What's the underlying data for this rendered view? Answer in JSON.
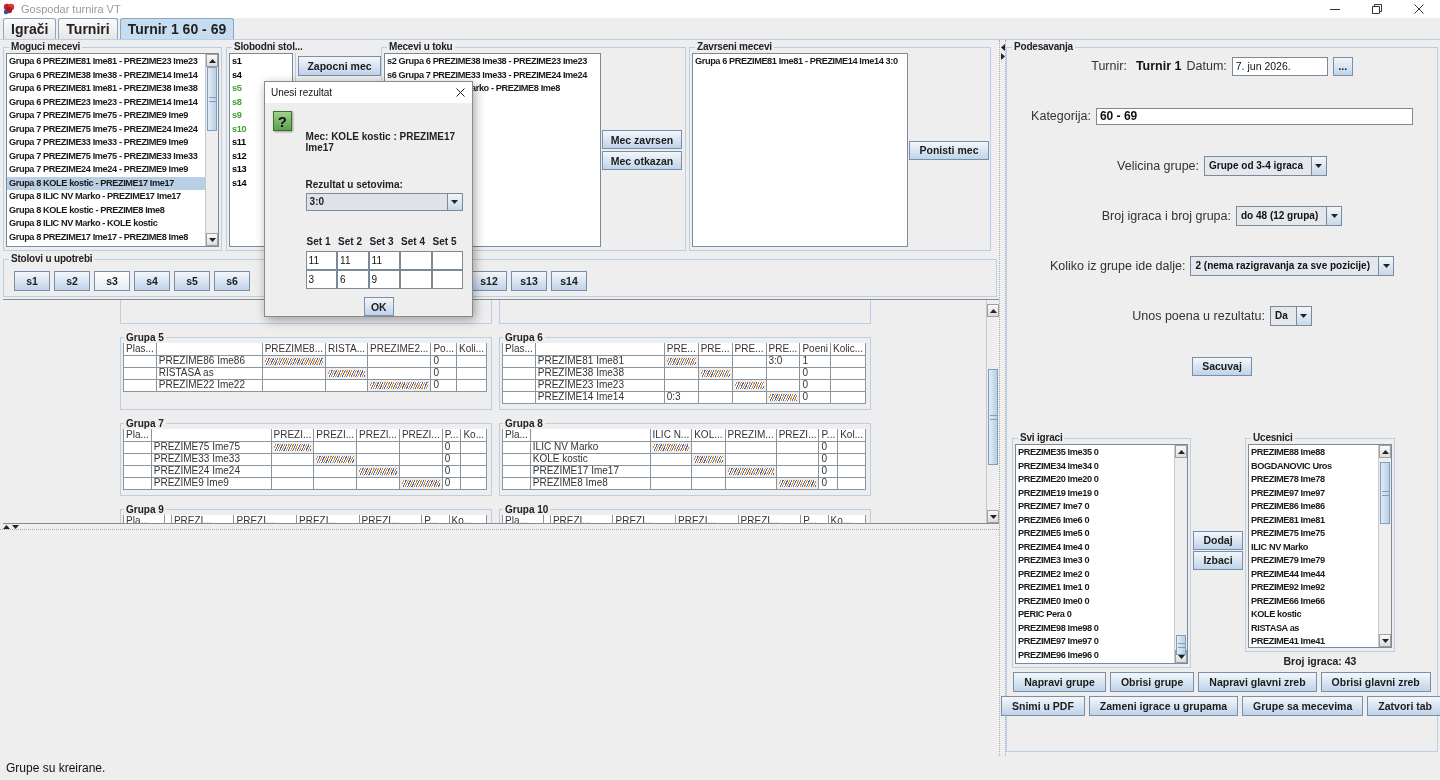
{
  "window": {
    "title": "Gospodar turnira VT"
  },
  "tabs": [
    {
      "label": "Igrači",
      "selected": false
    },
    {
      "label": "Turniri",
      "selected": false
    },
    {
      "label": "Turnir 1 60 - 69",
      "selected": true
    }
  ],
  "possible_matches": {
    "title": "Moguci mecevi",
    "items": [
      {
        "label": "Grupa 6 PREZIME81 Ime81 - PREZIME23 Ime23",
        "selected": false
      },
      {
        "label": "Grupa 6 PREZIME38 Ime38 - PREZIME14 Ime14",
        "selected": false
      },
      {
        "label": "Grupa 6 PREZIME81 Ime81 - PREZIME38 Ime38",
        "selected": false
      },
      {
        "label": "Grupa 6 PREZIME23 Ime23 - PREZIME14 Ime14",
        "selected": false
      },
      {
        "label": "Grupa 7 PREZIME75 Ime75 - PREZIME9 Ime9",
        "selected": false
      },
      {
        "label": "Grupa 7 PREZIME75 Ime75 - PREZIME24 Ime24",
        "selected": false
      },
      {
        "label": "Grupa 7 PREZIME33 Ime33 - PREZIME9 Ime9",
        "selected": false
      },
      {
        "label": "Grupa 7 PREZIME75 Ime75 - PREZIME33 Ime33",
        "selected": false
      },
      {
        "label": "Grupa 7 PREZIME24 Ime24 - PREZIME9 Ime9",
        "selected": false
      },
      {
        "label": "Grupa 8 KOLE kostic - PREZIME17 Ime17",
        "selected": true
      },
      {
        "label": "Grupa 8 ILIC NV Marko - PREZIME17 Ime17",
        "selected": false
      },
      {
        "label": "Grupa 8 KOLE kostic - PREZIME8 Ime8",
        "selected": false
      },
      {
        "label": "Grupa 8 ILIC NV Marko - KOLE kostic",
        "selected": false
      },
      {
        "label": "Grupa 8 PREZIME17 Ime17 - PREZIME8 Ime8",
        "selected": false
      }
    ]
  },
  "free_tables": {
    "title": "Slobodni stol...",
    "items": [
      {
        "label": "s1",
        "color": "#000000"
      },
      {
        "label": "s4",
        "color": "#000000"
      },
      {
        "label": "s5",
        "color": "#3f9f2f"
      },
      {
        "label": "s8",
        "color": "#3f9f2f"
      },
      {
        "label": "s9",
        "color": "#3f9f2f"
      },
      {
        "label": "s10",
        "color": "#3f9f2f"
      },
      {
        "label": "s11",
        "color": "#000000"
      },
      {
        "label": "s12",
        "color": "#000000"
      },
      {
        "label": "s13",
        "color": "#000000"
      },
      {
        "label": "s14",
        "color": "#000000"
      }
    ]
  },
  "start_button": "Zapocni mec",
  "matches_in_progress": {
    "title": "Mecevi u toku",
    "items": [
      {
        "label": "s2 Grupa 6 PREZIME38 Ime38 - PREZIME23 Ime23",
        "clipped": false
      },
      {
        "label": "s6 Grupa 7 PREZIME33 Ime33 - PREZIME24 Ime24",
        "clipped": false
      },
      {
        "label": "arko - PREZIME8 Ime8",
        "clipped": true
      }
    ],
    "buttons": [
      "Mec zavrsen",
      "Mec otkazan"
    ]
  },
  "finished_matches": {
    "title": "Zavrseni mecevi",
    "items": [
      "Grupa 6 PREZIME81 Ime81 - PREZIME14 Ime14 3:0"
    ],
    "button": "Ponisti mec"
  },
  "tables_in_use": {
    "title": "Stolovi u upotrebi",
    "buttons": [
      {
        "label": "s1",
        "highlighted": false
      },
      {
        "label": "s2",
        "highlighted": false
      },
      {
        "label": "s3",
        "highlighted": true
      },
      {
        "label": "s4",
        "highlighted": false
      },
      {
        "label": "s5",
        "highlighted": false
      },
      {
        "label": "s6",
        "highlighted": false
      },
      {
        "label": "s12",
        "highlighted": false
      },
      {
        "label": "s13",
        "highlighted": false
      },
      {
        "label": "s14",
        "highlighted": false
      }
    ]
  },
  "groups": [
    {
      "title": "Grupa 5",
      "columns": [
        "Plas...",
        null,
        "PREZIME8...",
        "RISTA...",
        "PREZIME2...",
        "Po...",
        "Koli..."
      ],
      "rows": [
        [
          null,
          "PREZIME86 Ime86",
          {
            "kind": "hatch"
          },
          null,
          null,
          "0",
          null
        ],
        [
          null,
          "RISTASA as",
          null,
          {
            "kind": "hatch"
          },
          null,
          "0",
          null
        ],
        [
          null,
          "PREZIME22 Ime22",
          null,
          null,
          {
            "kind": "hatch"
          },
          "0",
          null
        ]
      ]
    },
    {
      "title": "Grupa 6",
      "columns": [
        "Plas...",
        null,
        "PRE...",
        "PRE...",
        "PRE...",
        "PRE...",
        "Poeni",
        "Kolic..."
      ],
      "rows": [
        [
          null,
          "PREZIME81 Ime81",
          {
            "kind": "hatch"
          },
          null,
          null,
          "3:0",
          "1",
          null
        ],
        [
          null,
          "PREZIME38 Ime38",
          null,
          {
            "kind": "hatch"
          },
          null,
          null,
          "0",
          null
        ],
        [
          null,
          "PREZIME23 Ime23",
          null,
          null,
          {
            "kind": "hatch"
          },
          null,
          "0",
          null
        ],
        [
          null,
          "PREZIME14 Ime14",
          "0:3",
          null,
          null,
          {
            "kind": "hatch"
          },
          "0",
          null
        ]
      ]
    },
    {
      "title": "Grupa 7",
      "columns": [
        "Pla...",
        null,
        "PREZI...",
        "PREZI...",
        "PREZI...",
        "PREZI...",
        "P...",
        "Ko..."
      ],
      "rows": [
        [
          null,
          "PREZIME75 Ime75",
          {
            "kind": "hatch"
          },
          null,
          null,
          null,
          "0",
          null
        ],
        [
          null,
          "PREZIME33 Ime33",
          null,
          {
            "kind": "hatch"
          },
          null,
          null,
          "0",
          null
        ],
        [
          null,
          "PREZIME24 Ime24",
          null,
          null,
          {
            "kind": "hatch"
          },
          null,
          "0",
          null
        ],
        [
          null,
          "PREZIME9 Ime9",
          null,
          null,
          null,
          {
            "kind": "hatch"
          },
          "0",
          null
        ]
      ]
    },
    {
      "title": "Grupa 8",
      "columns": [
        "Pla...",
        null,
        "ILIC N...",
        "KOL...",
        "PREZIM...",
        "PREZI...",
        "P...",
        "Kol..."
      ],
      "rows": [
        [
          null,
          "ILIC NV Marko",
          {
            "kind": "hatch"
          },
          null,
          null,
          null,
          "0",
          null
        ],
        [
          null,
          "KOLE kostic",
          null,
          {
            "kind": "hatch"
          },
          null,
          null,
          "0",
          null
        ],
        [
          null,
          "PREZIME17 Ime17",
          null,
          null,
          {
            "kind": "hatch"
          },
          null,
          "0",
          null
        ],
        [
          null,
          "PREZIME8 Ime8",
          null,
          null,
          null,
          {
            "kind": "hatch"
          },
          "0",
          null
        ]
      ]
    },
    {
      "title": "Grupa 9",
      "columns": [
        "Pla...",
        null,
        "PREZI...",
        "PREZI...",
        "PREZI...",
        "PREZI...",
        "P...",
        "Ko..."
      ]
    },
    {
      "title": "Grupa 10",
      "columns": [
        "Pla...",
        null,
        "PREZI...",
        "PREZI...",
        "PREZI...",
        "PREZI...",
        "P...",
        "Ko..."
      ]
    }
  ],
  "dialog": {
    "title": "Unesi rezultat",
    "icon": "?",
    "match": "Mec: KOLE kostic : PREZIME17 Ime17",
    "result_label": "Rezultat u setovima:",
    "result": "3:0",
    "set_headers": [
      "Set 1",
      "Set 2",
      "Set 3",
      "Set 4",
      "Set 5"
    ],
    "set_rows": [
      [
        "11",
        "11",
        "11",
        null,
        null
      ],
      [
        "3",
        "6",
        "9",
        null,
        null
      ]
    ],
    "ok_button": "OK"
  },
  "settings": {
    "title": "Podesavanja",
    "tournament_label": "Turnir:",
    "tournament_name": "Turnir 1",
    "date_label": "Datum:",
    "date": "7. jun 2026.",
    "date_button": "...",
    "category_label": "Kategorija:",
    "category": "60 - 69",
    "combos": [
      {
        "label": "Velicina grupe:",
        "value": "Grupe od 3-4 igraca"
      },
      {
        "label": "Broj igraca i broj grupa:",
        "value": "do 48 (12 grupa)"
      },
      {
        "label": "Koliko iz grupe ide dalje:",
        "value": "2 (nema razigravanja za sve pozicije)"
      },
      {
        "label": "Unos poena u rezultatu:",
        "value": "Da"
      }
    ],
    "save_button": "Sacuvaj",
    "all_players": {
      "title": "Svi igraci",
      "items": [
        "PREZIME35 Ime35 0",
        "PREZIME34 Ime34 0",
        "PREZIME20 Ime20 0",
        "PREZIME19 Ime19 0",
        "PREZIME7 Ime7 0",
        "PREZIME6 Ime6 0",
        "PREZIME5 Ime5 0",
        "PREZIME4 Ime4 0",
        "PREZIME3 Ime3 0",
        "PREZIME2 Ime2 0",
        "PREZIME1 Ime1 0",
        "PREZIME0 Ime0 0",
        "PERIC Pera 0",
        "PREZIME98 Ime98 0",
        "PREZIME97 Ime97 0",
        "PREZIME96 Ime96 0"
      ]
    },
    "add_button": "Dodaj",
    "remove_button": "Izbaci",
    "participants": {
      "title": "Ucesnici",
      "items": [
        "PREZIME88 Ime88",
        "BOGDANOVIC Uros",
        "PREZIME78 Ime78",
        "PREZIME97 Ime97",
        "PREZIME86 Ime86",
        "PREZIME81 Ime81",
        "PREZIME75 Ime75",
        "ILIC NV Marko",
        "PREZIME79 Ime79",
        "PREZIME44 Ime44",
        "PREZIME92 Ime92",
        "PREZIME66 Ime66",
        "KOLE kostic",
        "RISTASA as",
        "PREZIME41 Ime41"
      ]
    },
    "player_count": "Broj igraca: 43",
    "action_rows": [
      [
        "Napravi grupe",
        "Obrisi grupe",
        "Napravi glavni zreb",
        "Obrisi glavni zreb"
      ],
      [
        "Snimi u PDF",
        "Zameni igrace u grupama",
        "Grupe sa mecevima",
        "Zatvori tab"
      ]
    ]
  },
  "status_bar": "Grupe su kreirane."
}
